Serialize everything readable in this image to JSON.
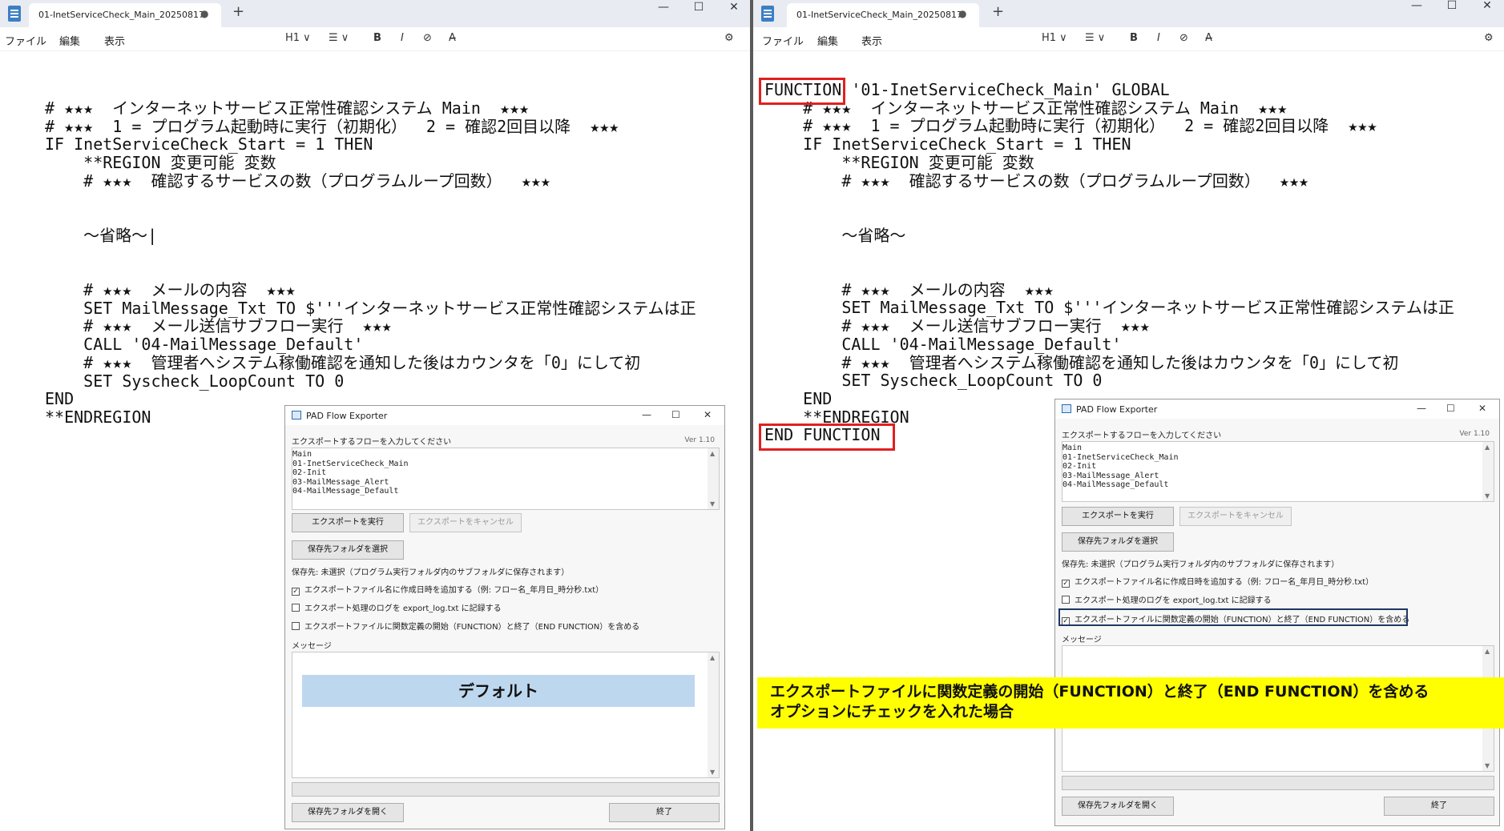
{
  "editor": {
    "tab_title": "01-InetServiceCheck_Main_20250817",
    "tab_modified_dot": "●",
    "new_tab": "+",
    "menu": [
      "ファイル",
      "編集",
      "表示"
    ],
    "toolbar": {
      "heading": "H1 ∨",
      "list": "☰ ∨",
      "bold": "B",
      "italic": "I",
      "link": "⊘",
      "clear": "A̶"
    },
    "window_controls": {
      "minimize": "—",
      "maximize": "☐",
      "close": "✕"
    }
  },
  "left": {
    "code": "# ★★★  インターネットサービス正常性確認システム Main  ★★★\n# ★★★  1 = プログラム起動時に実行（初期化）  2 = 確認2回目以降  ★★★\nIF InetServiceCheck_Start = 1 THEN\n    **REGION 変更可能 変数\n    # ★★★  確認するサービスの数（プログラムループ回数）  ★★★\n\n\n    ～省略～|\n\n\n    # ★★★  メールの内容  ★★★\n    SET MailMessage_Txt TO $'''インターネットサービス正常性確認システムは正\n    # ★★★  メール送信サブフロー実行  ★★★\n    CALL '04-MailMessage_Default'\n    # ★★★  管理者へシステム稼働確認を通知した後はカウンタを「0」にして初\n    SET Syscheck_LoopCount TO 0\nEND\n**ENDREGION",
    "banner": "デフォルト"
  },
  "right": {
    "code": "FUNCTION '01-InetServiceCheck_Main' GLOBAL\n    # ★★★  インターネットサービス正常性確認システム Main  ★★★\n    # ★★★  1 = プログラム起動時に実行（初期化）  2 = 確認2回目以降  ★★★\n    IF InetServiceCheck_Start = 1 THEN\n        **REGION 変更可能 変数\n        # ★★★  確認するサービスの数（プログラムループ回数）  ★★★\n\n\n        ～省略～\n\n\n        # ★★★  メールの内容  ★★★\n        SET MailMessage_Txt TO $'''インターネットサービス正常性確認システムは正\n        # ★★★  メール送信サブフロー実行  ★★★\n        CALL '04-MailMessage_Default'\n        # ★★★  管理者へシステム稼働確認を通知した後はカウンタを「0」にして初\n        SET Syscheck_LoopCount TO 0\n    END\n    **ENDREGION\nEND FUNCTION",
    "caption_line1": "エクスポートファイルに関数定義の開始（FUNCTION）と終了（END FUNCTION）を含める",
    "caption_line2": "オプションにチェックを入れた場合"
  },
  "dialog": {
    "title": "PAD Flow Exporter",
    "controls": {
      "minimize": "—",
      "maximize": "☐",
      "close": "✕"
    },
    "prompt": "エクスポートするフローを入力してください",
    "version": "Ver 1.10",
    "flows": "Main\n01-InetServiceCheck_Main\n02-Init\n03-MailMessage_Alert\n04-MailMessage_Default",
    "export_button": "エクスポートを実行",
    "cancel_button": "エクスポートをキャンセル",
    "select_folder_button": "保存先フォルダを選択",
    "save_to": "保存先: 未選択（プログラム実行フォルダ内のサブフォルダに保存されます）",
    "option_datetime": "エクスポートファイル名に作成日時を追加する（例: フロー名_年月日_時分秒.txt）",
    "option_log": "エクスポート処理のログを export_log.txt に記録する",
    "option_function": "エクスポートファイルに関数定義の開始（FUNCTION）と終了（END FUNCTION）を含める",
    "message_label": "メッセージ",
    "open_folder_button": "保存先フォルダを開く",
    "exit_button": "終了",
    "check_mark": "✓"
  },
  "colors": {
    "red_box": "#e02020",
    "yellow_caption": "#ffff00",
    "default_banner": "#bdd7ee",
    "highlight_navy": "#1f3864"
  }
}
